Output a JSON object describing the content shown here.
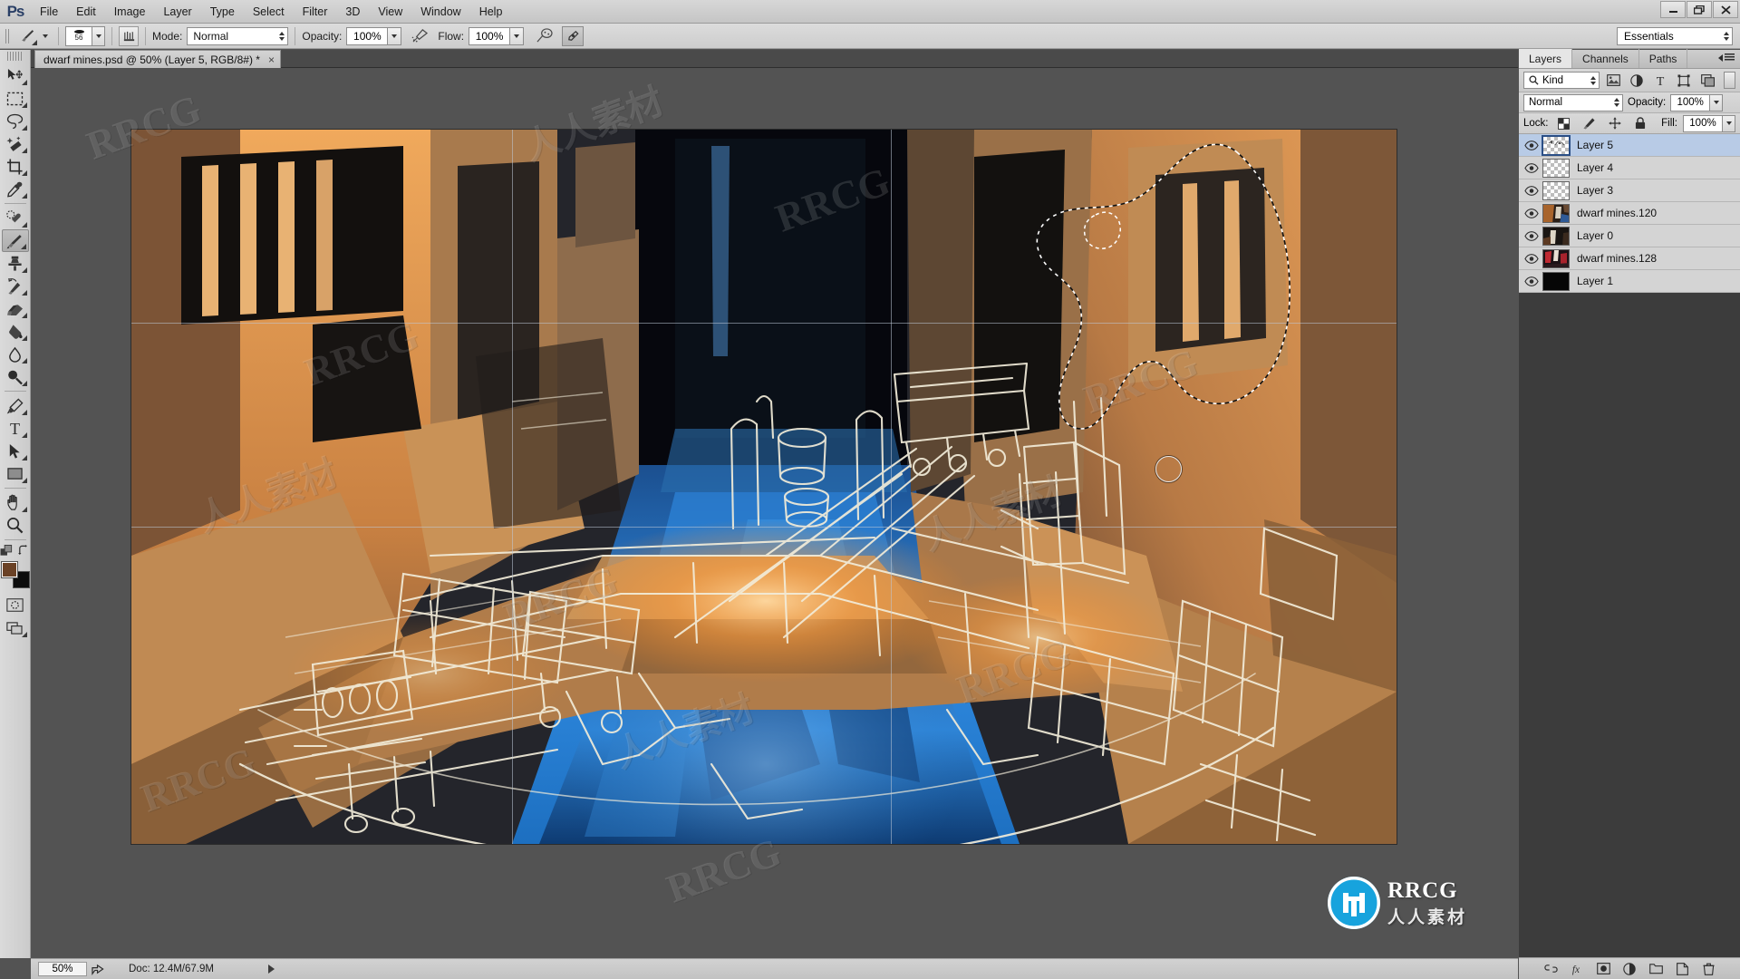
{
  "app": {
    "name": "Adobe Photoshop",
    "logo_text": "Ps"
  },
  "menubar": {
    "items": [
      {
        "label": "File"
      },
      {
        "label": "Edit"
      },
      {
        "label": "Image"
      },
      {
        "label": "Layer"
      },
      {
        "label": "Type"
      },
      {
        "label": "Select"
      },
      {
        "label": "Filter"
      },
      {
        "label": "3D"
      },
      {
        "label": "View"
      },
      {
        "label": "Window"
      },
      {
        "label": "Help"
      }
    ]
  },
  "window_controls": {
    "minimize": "minimize-icon",
    "restore": "restore-icon",
    "close": "close-icon"
  },
  "options_bar": {
    "tool": "brush-tool",
    "brush_size": "56",
    "mode_label": "Mode:",
    "mode_value": "Normal",
    "opacity_label": "Opacity:",
    "opacity_value": "100%",
    "flow_label": "Flow:",
    "flow_value": "100%",
    "airbrush_icon": "airbrush-icon",
    "tablet_pressure_icon": "tablet-pressure-icon"
  },
  "workspace": {
    "selected": "Essentials"
  },
  "document": {
    "tab_title": "dwarf mines.psd @ 50% (Layer 5, RGB/8#) *",
    "close_label": "×"
  },
  "toolbar": {
    "tools": [
      {
        "name": "move-tool",
        "icon": "move",
        "has_flyout": true,
        "active": false
      },
      {
        "name": "rectangular-marquee-tool",
        "icon": "marquee",
        "has_flyout": true,
        "active": false
      },
      {
        "name": "lasso-tool",
        "icon": "lasso",
        "has_flyout": true,
        "active": false
      },
      {
        "name": "quick-selection-tool",
        "icon": "magicwand",
        "has_flyout": true,
        "active": false
      },
      {
        "name": "crop-tool",
        "icon": "crop",
        "has_flyout": true,
        "active": false
      },
      {
        "name": "eyedropper-tool",
        "icon": "eyedropper",
        "has_flyout": true,
        "active": false
      },
      {
        "name": "spot-healing-brush-tool",
        "icon": "healing",
        "has_flyout": true,
        "active": false
      },
      {
        "name": "brush-tool",
        "icon": "brush",
        "has_flyout": true,
        "active": true
      },
      {
        "name": "clone-stamp-tool",
        "icon": "stamp",
        "has_flyout": true,
        "active": false
      },
      {
        "name": "history-brush-tool",
        "icon": "historybrush",
        "has_flyout": true,
        "active": false
      },
      {
        "name": "eraser-tool",
        "icon": "eraser",
        "has_flyout": true,
        "active": false
      },
      {
        "name": "gradient-tool",
        "icon": "paintbucket",
        "has_flyout": true,
        "active": false
      },
      {
        "name": "blur-tool",
        "icon": "blur",
        "has_flyout": true,
        "active": false
      },
      {
        "name": "dodge-tool",
        "icon": "dodge",
        "has_flyout": true,
        "active": false
      },
      {
        "name": "pen-tool",
        "icon": "pen",
        "has_flyout": true,
        "active": false
      },
      {
        "name": "horizontal-type-tool",
        "icon": "type",
        "has_flyout": true,
        "active": false
      },
      {
        "name": "path-selection-tool",
        "icon": "pathselect",
        "has_flyout": true,
        "active": false
      },
      {
        "name": "rectangle-tool",
        "icon": "rectangle",
        "has_flyout": true,
        "active": false
      },
      {
        "name": "hand-tool",
        "icon": "hand",
        "has_flyout": true,
        "active": false
      },
      {
        "name": "zoom-tool",
        "icon": "zoom",
        "has_flyout": false,
        "active": false
      }
    ],
    "foreground_color": "#6b4226",
    "background_color": "#0d0d0d",
    "quickmask_name": "quick-mask-mode",
    "screenmode_name": "screen-mode"
  },
  "layers_panel": {
    "tabs": [
      {
        "label": "Layers",
        "active": true
      },
      {
        "label": "Channels",
        "active": false
      },
      {
        "label": "Paths",
        "active": false
      }
    ],
    "filter": {
      "kind_label": "Kind",
      "icons": [
        "pixel-filter-icon",
        "adjustment-filter-icon",
        "type-filter-icon",
        "shape-filter-icon",
        "smartobject-filter-icon"
      ]
    },
    "blend_mode": "Normal",
    "opacity_label": "Opacity:",
    "opacity_value": "100%",
    "lock_label": "Lock:",
    "lock_icons": [
      "lock-transparent-pixels-icon",
      "lock-image-pixels-icon",
      "lock-position-icon",
      "lock-all-icon"
    ],
    "fill_label": "Fill:",
    "fill_value": "100%",
    "layers": [
      {
        "name": "Layer 5",
        "visible": true,
        "selected": true,
        "thumb": "transparent-strokes"
      },
      {
        "name": "Layer 4",
        "visible": true,
        "selected": false,
        "thumb": "transparent"
      },
      {
        "name": "Layer 3",
        "visible": true,
        "selected": false,
        "thumb": "transparent"
      },
      {
        "name": "dwarf mines.120",
        "visible": true,
        "selected": false,
        "thumb": "image-warm"
      },
      {
        "name": "Layer 0",
        "visible": true,
        "selected": false,
        "thumb": "image-dark"
      },
      {
        "name": "dwarf mines.128",
        "visible": true,
        "selected": false,
        "thumb": "image-red"
      },
      {
        "name": "Layer 1",
        "visible": true,
        "selected": false,
        "thumb": "image-black"
      }
    ],
    "footer_icons": [
      "link-layers-icon",
      "layer-style-icon",
      "layer-mask-icon",
      "new-fill-adjustment-icon",
      "new-group-icon",
      "new-layer-icon",
      "delete-layer-icon"
    ]
  },
  "status_bar": {
    "zoom": "50%",
    "share_icon": "share-icon",
    "doc_info": "Doc: 12.4M/67.9M",
    "expand_icon": "expand-arrow-icon"
  },
  "watermarks": {
    "latin": "RRCG",
    "cjk": "人人素材",
    "badge_latin": "RRCG",
    "badge_cjk": "人人素材"
  },
  "colors": {
    "accent": "#17a3dd",
    "selection_blue": "#b8cbe6",
    "canvas_bg": "#535353",
    "panel_bg": "#d6d6d6",
    "chrome": "#cdcdcd"
  }
}
